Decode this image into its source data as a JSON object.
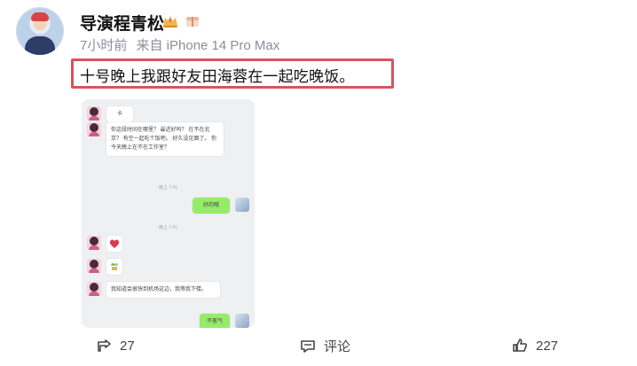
{
  "post": {
    "username": "导演程青松",
    "time": "7小时前",
    "source": "来自 iPhone 14 Pro Max",
    "text": "十号晚上我跟好友田海蓉在一起吃晚饭。"
  },
  "screenshot": {
    "top_label": "卡",
    "message_1": "你这段时间在哪里？ 最近好吗？ 在不在北京？ 有空一起吃个饭吧。 好久没见面了。 你今天晚上在不在工作室？",
    "time_1": "晚上 7:41",
    "reply_1": "好的哦",
    "time_2": "晚上 7:41",
    "message_2": "我知道会很快到机场这边，我等我下楼。",
    "reply_2": "不客气"
  },
  "actions": {
    "share_count": "27",
    "comment_label": "评论",
    "like_count": "227"
  }
}
